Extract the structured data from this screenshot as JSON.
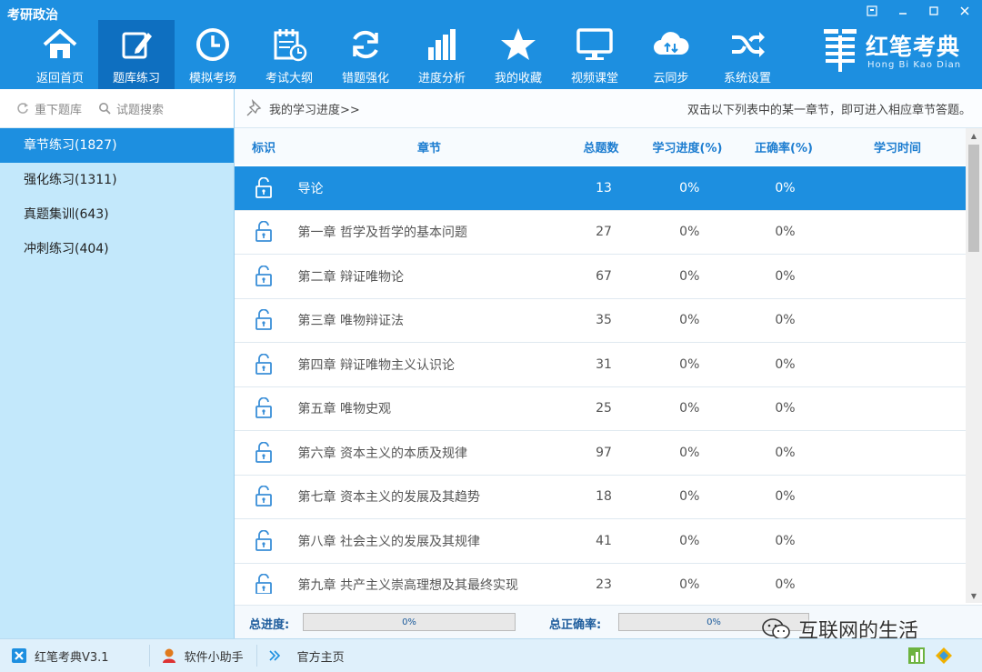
{
  "app": {
    "title": "考研政治"
  },
  "window": {
    "buttons": [
      "restore-icon",
      "minimize-icon",
      "maximize-icon",
      "close-icon"
    ]
  },
  "nav": {
    "items": [
      {
        "label": "返回首页",
        "icon": "home-icon"
      },
      {
        "label": "题库练习",
        "icon": "edit-icon",
        "active": true
      },
      {
        "label": "模拟考场",
        "icon": "clock-icon"
      },
      {
        "label": "考试大纲",
        "icon": "calendar-icon"
      },
      {
        "label": "错题强化",
        "icon": "refresh-icon"
      },
      {
        "label": "进度分析",
        "icon": "bar-chart-icon"
      },
      {
        "label": "我的收藏",
        "icon": "star-icon"
      },
      {
        "label": "视频课堂",
        "icon": "monitor-icon"
      },
      {
        "label": "云同步",
        "icon": "cloud-icon"
      },
      {
        "label": "系统设置",
        "icon": "shuffle-icon"
      }
    ]
  },
  "brand": {
    "name": "红笔考典",
    "sub": "Hong Bi Kao Dian"
  },
  "sidebar": {
    "tools": {
      "reload": "重下题库",
      "search": "试题搜索"
    },
    "categories": [
      {
        "label": "章节练习(1827)",
        "active": true
      },
      {
        "label": "强化练习(1311)"
      },
      {
        "label": "真题集训(643)"
      },
      {
        "label": "冲刺练习(404)"
      }
    ]
  },
  "main": {
    "progress_link": "我的学习进度>>",
    "hint": "双击以下列表中的某一章节，即可进入相应章节答题。",
    "columns": [
      "标识",
      "章节",
      "总题数",
      "学习进度(%)",
      "正确率(%)",
      "学习时间"
    ],
    "rows": [
      {
        "chapter": "导论",
        "total": "13",
        "progress": "0%",
        "accuracy": "0%",
        "time": ""
      },
      {
        "chapter": "第一章 哲学及哲学的基本问题",
        "total": "27",
        "progress": "0%",
        "accuracy": "0%",
        "time": ""
      },
      {
        "chapter": "第二章 辩证唯物论",
        "total": "67",
        "progress": "0%",
        "accuracy": "0%",
        "time": ""
      },
      {
        "chapter": "第三章 唯物辩证法",
        "total": "35",
        "progress": "0%",
        "accuracy": "0%",
        "time": ""
      },
      {
        "chapter": "第四章 辩证唯物主义认识论",
        "total": "31",
        "progress": "0%",
        "accuracy": "0%",
        "time": ""
      },
      {
        "chapter": "第五章 唯物史观",
        "total": "25",
        "progress": "0%",
        "accuracy": "0%",
        "time": ""
      },
      {
        "chapter": "第六章 资本主义的本质及规律",
        "total": "97",
        "progress": "0%",
        "accuracy": "0%",
        "time": ""
      },
      {
        "chapter": "第七章 资本主义的发展及其趋势",
        "total": "18",
        "progress": "0%",
        "accuracy": "0%",
        "time": ""
      },
      {
        "chapter": "第八章 社会主义的发展及其规律",
        "total": "41",
        "progress": "0%",
        "accuracy": "0%",
        "time": ""
      },
      {
        "chapter": "第九章 共产主义崇高理想及其最终实现",
        "total": "23",
        "progress": "0%",
        "accuracy": "0%",
        "time": ""
      }
    ],
    "footer": {
      "total_progress_label": "总进度:",
      "total_progress_value": "0%",
      "total_accuracy_label": "总正确率:",
      "total_accuracy_value": "0%"
    }
  },
  "watermark": "互联网的生活",
  "statusbar": {
    "version": "红笔考典V3.1",
    "helper": "软件小助手",
    "home": "官方主页"
  },
  "colors": {
    "primary": "#1d8fe0",
    "nav_active": "#0e6fc0",
    "sidebar_bg": "#c3e8fb",
    "header_text": "#1d7dd0"
  }
}
